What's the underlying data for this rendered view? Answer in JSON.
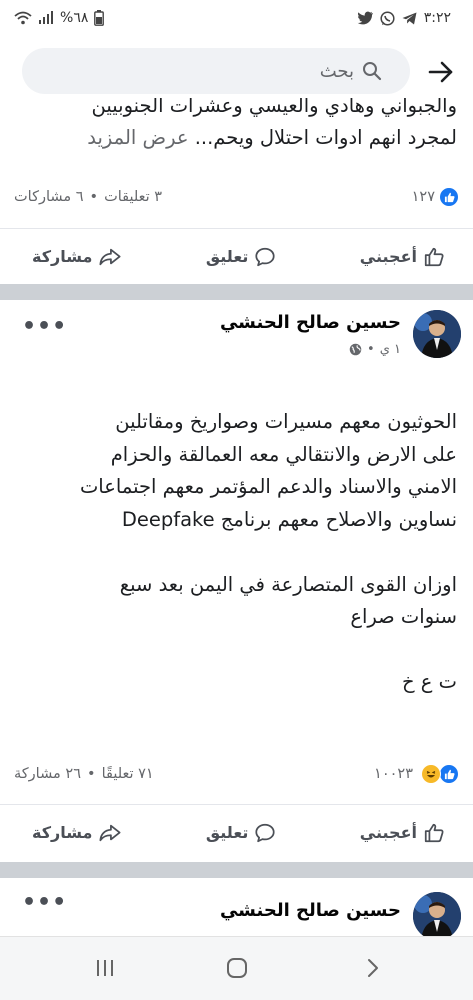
{
  "status_bar": {
    "time": "٣:٢٢",
    "battery": "%٦٨"
  },
  "search": {
    "placeholder": "بحث"
  },
  "previous_post": {
    "text_line_1": "والجبواني وهادي والعيسي وعشرات الجنوبيين",
    "text_line_2": "لمجرد انهم ادوات احتلال ويحم...",
    "see_more": "عرض المزيد",
    "reactions_count": "١٢٧",
    "comments": "٣ تعليقات",
    "shares": "٦ مشاركات",
    "separator": "•"
  },
  "actions": {
    "like": "أعجبني",
    "comment": "تعليق",
    "share": "مشاركة"
  },
  "post": {
    "author": "حسين صالح الحنشي",
    "time": "١ ي",
    "privacy_dot": "•",
    "lines": [
      "الحوثيون معهم مسيرات وصواريخ ومقاتلين",
      "على الارض والانتقالي معه العمالقة والحزام",
      "الامني والاسناد والدعم المؤتمر معهم اجتماعات",
      "نساوين والاصلاح معهم برنامج Deepfake",
      "",
      "اوزان  القوى المتصارعة في اليمن بعد سبع",
      "سنوات صراع",
      "",
      "ت ع خ"
    ],
    "reactions_count": "١٠٠٢٣",
    "comments": "٧١ تعليقًا",
    "shares": "٢٦ مشاركة",
    "separator": "•"
  },
  "next_post": {
    "author": "حسين صالح الحنشي"
  },
  "more_menu": "•••",
  "icons": {
    "back": "arrow-right-icon",
    "search": "search-icon",
    "like": "thumbs-up-icon",
    "comment": "speech-bubble-icon",
    "share": "share-arrow-icon",
    "globe": "globe-icon",
    "haha": "haha-emoji-icon"
  },
  "colors": {
    "facebook_blue": "#1877f2",
    "haha_yellow": "#f7b928",
    "separator": "#ccd0d5",
    "secondary_text": "#65676b"
  }
}
